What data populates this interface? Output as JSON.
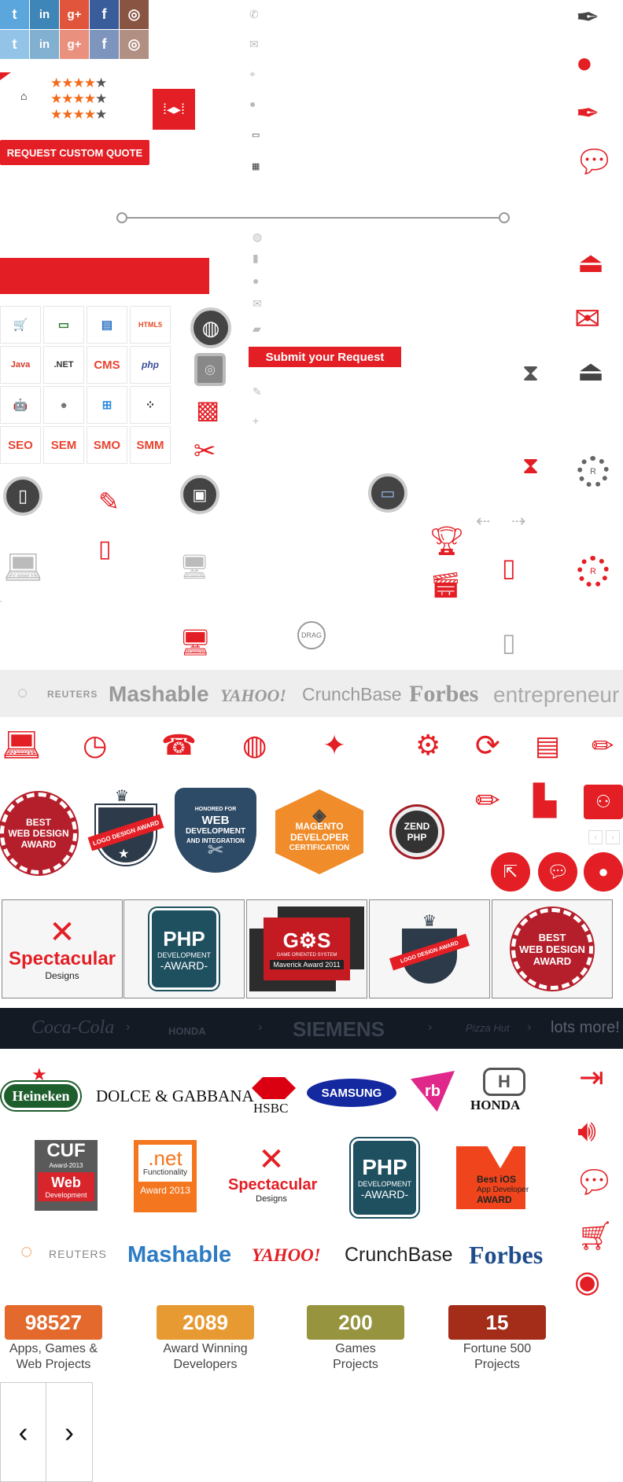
{
  "social": {
    "twitter": "t",
    "linkedin": "in",
    "googleplus": "g+",
    "facebook": "f",
    "instagram": "◎"
  },
  "ratings": {
    "stars_full": "★★★★",
    "stars_empty": "★"
  },
  "quote_button": "REQUEST CUSTOM QUOTE",
  "submit_button": "Submit your Request",
  "tech_tiles": [
    "🛒",
    "▭",
    "▤",
    "HTML5",
    "Java",
    ".NET",
    "CMS",
    "php",
    "🤖",
    "",
    "⊞",
    "⁘",
    "SEO",
    "SEM",
    "SMO",
    "SMM"
  ],
  "drag_label": "DRAG",
  "media_gray": [
    "REUTERS",
    "Mashable",
    "YAHOO!",
    "CrunchBase",
    "Forbes",
    "entrepreneur"
  ],
  "award_badges": {
    "best_web_design": [
      "BEST",
      "WEB DESIGN",
      "AWARD"
    ],
    "logo_design": "LOGO DESIGN AWARD",
    "web_dev": [
      "HONORED FOR",
      "WEB",
      "DEVELOPMENT",
      "AND INTEGRATION"
    ],
    "magento": [
      "MAGENTO DEVELOPER",
      "CERTIFICATION"
    ],
    "zend": [
      "ZEND PHP"
    ]
  },
  "award_boxes": {
    "spectacular": [
      "Spectacular",
      "Designs"
    ],
    "php": [
      "PHP",
      "DEVELOPMENT",
      "-AWARD-"
    ],
    "gas": [
      "G⚙S",
      "GAME ORIENTED SYSTEM",
      "Maverick Award 2011"
    ],
    "logo": "LOGO DESIGN AWARD",
    "best": [
      "BEST",
      "WEB DESIGN",
      "AWARD"
    ]
  },
  "brand_strip": [
    "Coca-Cola",
    "HONDA",
    "SIEMENS",
    "Pizza Hut",
    "lots more!"
  ],
  "brands": [
    "Heineken",
    "DOLCE & GABBANA",
    "HSBC",
    "SAMSUNG",
    "rb",
    "HONDA"
  ],
  "award_logos": {
    "cuf": [
      "CUF",
      "Award-2013",
      "Web",
      "Development"
    ],
    "net": [
      ".net",
      "Functionality",
      "Award 2013"
    ],
    "spectacular": [
      "Spectacular",
      "Designs"
    ],
    "php": [
      "PHP",
      "DEVELOPMENT",
      "-AWARD-"
    ],
    "ios": [
      "Best iOS",
      "App Developer",
      "AWARD"
    ]
  },
  "media_color": [
    "REUTERS",
    "Mashable",
    "YAHOO!",
    "CrunchBase",
    "Forbes"
  ],
  "stats": [
    {
      "value": "98527",
      "label1": "Apps, Games &",
      "label2": "Web Projects",
      "color": "#e3692c"
    },
    {
      "value": "2089",
      "label1": "Award Winning",
      "label2": "Developers",
      "color": "#e79a32"
    },
    {
      "value": "200",
      "label1": "Games",
      "label2": "Projects",
      "color": "#979440"
    },
    {
      "value": "15",
      "label1": "Fortune 500",
      "label2": "Projects",
      "color": "#a42d19"
    }
  ],
  "nav": {
    "prev": "‹",
    "next": "›"
  },
  "colors": {
    "accent": "#e31e24",
    "dark": "#444444",
    "strip": "#131a24"
  }
}
